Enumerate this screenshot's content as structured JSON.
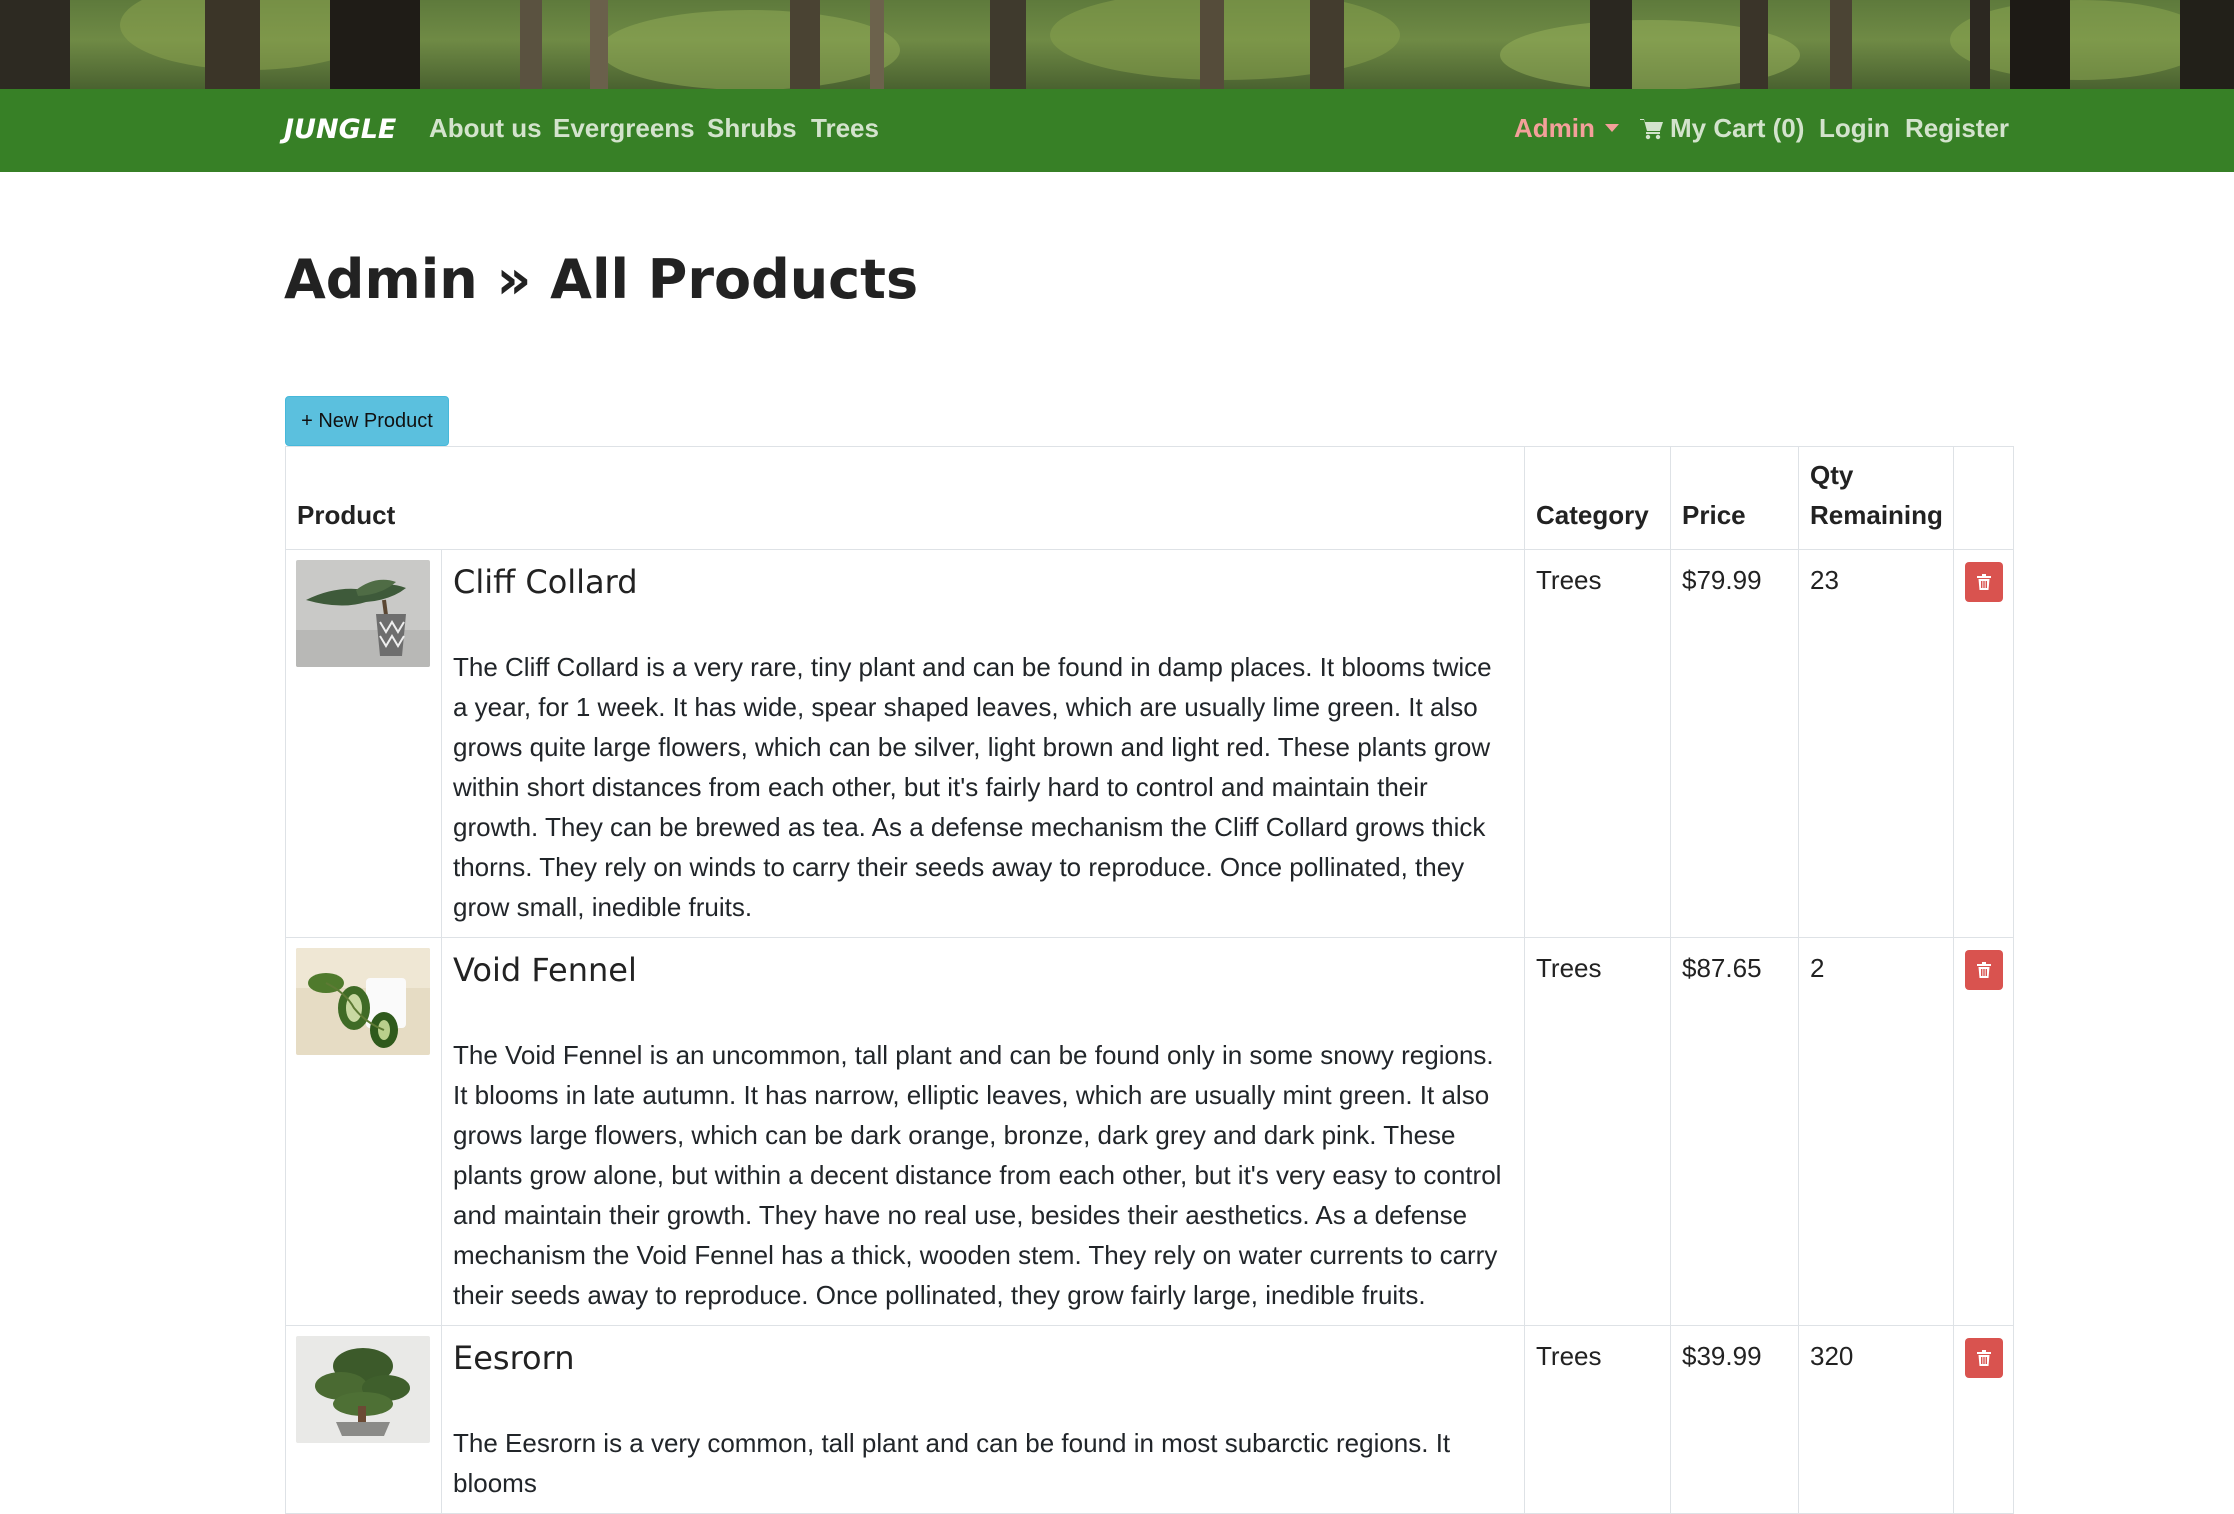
{
  "navbar": {
    "brand": "JUNGLE",
    "links": [
      "About us",
      "Evergreens",
      "Shrubs",
      "Trees"
    ],
    "admin": "Admin",
    "cart": "My Cart (0)",
    "login": "Login",
    "register": "Register"
  },
  "page": {
    "title": "Admin » All Products",
    "new_button": "+ New Product"
  },
  "table": {
    "headers": {
      "product": "Product",
      "category": "Category",
      "price": "Price",
      "qty": "Qty Remaining"
    },
    "rows": [
      {
        "name": "Cliff Collard",
        "description": "The Cliff Collard is a very rare, tiny plant and can be found in damp places. It blooms twice a year, for 1 week. It has wide, spear shaped leaves, which are usually lime green. It also grows quite large flowers, which can be silver, light brown and light red. These plants grow within short distances from each other, but it's fairly hard to control and maintain their growth. They can be brewed as tea. As a defense mechanism the Cliff Collard grows thick thorns. They rely on winds to carry their seeds away to reproduce. Once pollinated, they grow small, inedible fruits.",
        "category": "Trees",
        "price": "$79.99",
        "qty": "23"
      },
      {
        "name": "Void Fennel",
        "description": "The Void Fennel is an uncommon, tall plant and can be found only in some snowy regions. It blooms in late autumn. It has narrow, elliptic leaves, which are usually mint green. It also grows large flowers, which can be dark orange, bronze, dark grey and dark pink. These plants grow alone, but within a decent distance from each other, but it's very easy to control and maintain their growth. They have no real use, besides their aesthetics. As a defense mechanism the Void Fennel has a thick, wooden stem. They rely on water currents to carry their seeds away to reproduce. Once pollinated, they grow fairly large, inedible fruits.",
        "category": "Trees",
        "price": "$87.65",
        "qty": "2"
      },
      {
        "name": "Eesrorn",
        "description": "The Eesrorn is a very common, tall plant and can be found in most subarctic regions. It blooms",
        "category": "Trees",
        "price": "$39.99",
        "qty": "320"
      }
    ]
  },
  "colors": {
    "navbar": "#378026",
    "admin_link": "#f4a09a",
    "new_button": "#5bc0de",
    "delete_button": "#d9534f"
  }
}
